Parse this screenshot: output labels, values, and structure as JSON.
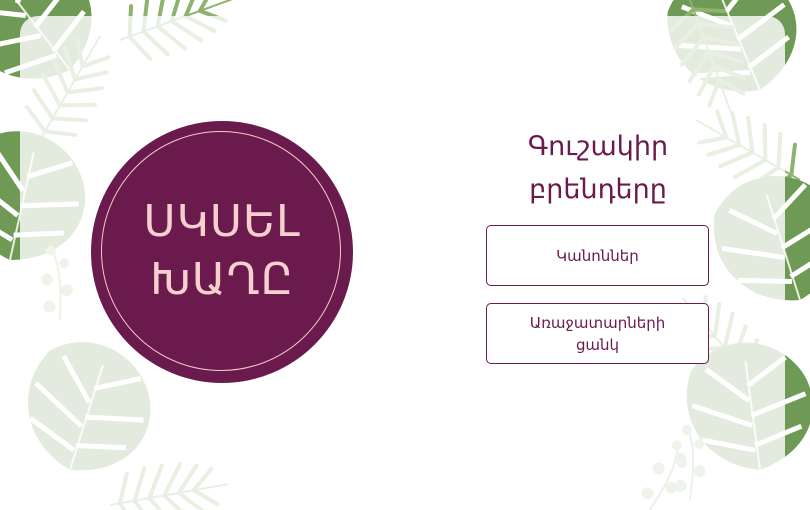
{
  "start_button": {
    "line1": "ՍԿՍԵԼ",
    "line2": "ԽԱՂԸ"
  },
  "title": {
    "line1": "Գուշակիր",
    "line2": "բրենդերը"
  },
  "menu": {
    "rules_label": "Կանոններ",
    "questions_line1": "Առաջատարների",
    "questions_line2": "ցանկ"
  },
  "colors": {
    "accent": "#6b1a4d",
    "start_text": "#f7cfcf",
    "leaf_dark": "#4f7d3a",
    "leaf_light": "#b9cfa8"
  }
}
